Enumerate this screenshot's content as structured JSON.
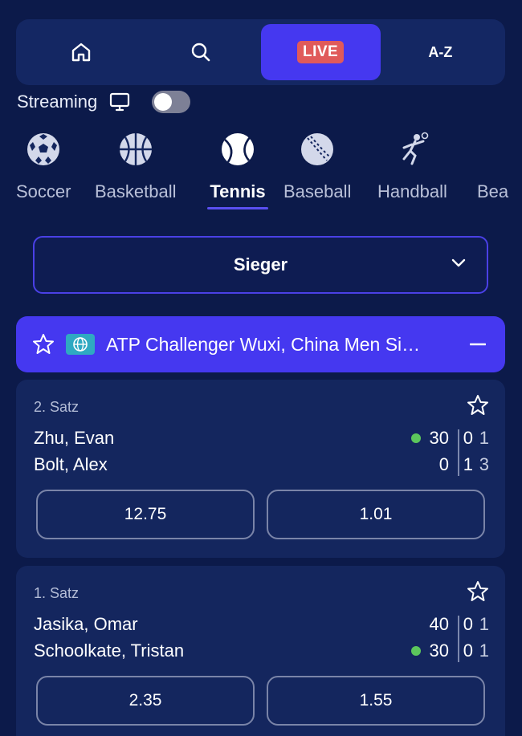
{
  "nav": {
    "items": [
      {
        "name": "home",
        "icon": "home-icon"
      },
      {
        "name": "search",
        "icon": "search-icon"
      },
      {
        "name": "live",
        "label": "LIVE",
        "active": true
      },
      {
        "name": "az",
        "label": "A-Z"
      }
    ]
  },
  "streaming": {
    "label": "Streaming",
    "icon": "monitor-icon",
    "enabled": false
  },
  "sports": [
    {
      "label": "Soccer",
      "icon": "soccer-ball-icon"
    },
    {
      "label": "Basketball",
      "icon": "basketball-icon"
    },
    {
      "label": "Tennis",
      "icon": "tennis-ball-icon",
      "active": true
    },
    {
      "label": "Baseball",
      "icon": "baseball-icon"
    },
    {
      "label": "Handball",
      "icon": "handball-player-icon"
    },
    {
      "label": "Bea",
      "icon": ""
    }
  ],
  "market_select": {
    "value": "Sieger"
  },
  "league": {
    "name": "ATP Challenger Wuxi, China Men Si…"
  },
  "matches": [
    {
      "set": "2. Satz",
      "players": [
        {
          "name": "Zhu, Evan",
          "game": "30",
          "set1": "0",
          "set2": "1",
          "serving": true
        },
        {
          "name": "Bolt, Alex",
          "game": "0",
          "set1": "1",
          "set2": "3",
          "serving": false
        }
      ],
      "odds": [
        "12.75",
        "1.01"
      ]
    },
    {
      "set": "1. Satz",
      "players": [
        {
          "name": "Jasika, Omar",
          "game": "40",
          "set1": "0",
          "set2": "1",
          "serving": false
        },
        {
          "name": "Schoolkate, Tristan",
          "game": "30",
          "set1": "0",
          "set2": "1",
          "serving": true
        }
      ],
      "odds": [
        "2.35",
        "1.55"
      ]
    }
  ],
  "colors": {
    "background": "#0c1a4a",
    "accent": "#4538f0",
    "live": "#e05a5a",
    "serve": "#5cc65c"
  }
}
